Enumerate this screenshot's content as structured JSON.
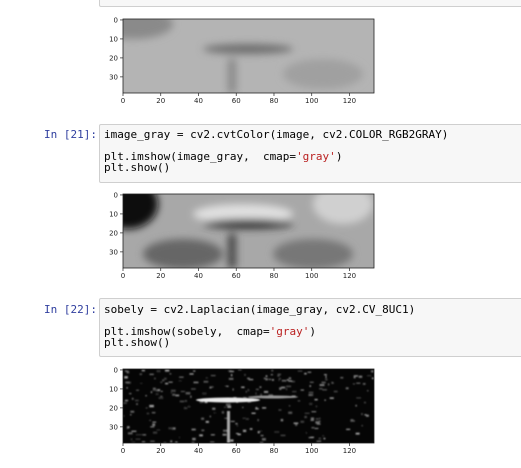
{
  "cells": [
    {
      "prompt": "",
      "code": []
    },
    {
      "prompt": "In [21]:",
      "code": [
        {
          "a": "image_gray = cv2.cvtColor(image, cv2.COLOR_RGB2GRAY)",
          "s": "",
          "b": ""
        },
        {
          "a": "",
          "s": "",
          "b": ""
        },
        {
          "a": "plt.imshow(image_gray,  cmap=",
          "s": "'gray'",
          "b": ")"
        },
        {
          "a": "plt.show()",
          "s": "",
          "b": ""
        }
      ]
    },
    {
      "prompt": "In [22]:",
      "code": [
        {
          "a": "sobely = cv2.Laplacian(image_gray, cv2.CV_8UC1)",
          "s": "",
          "b": ""
        },
        {
          "a": "",
          "s": "",
          "b": ""
        },
        {
          "a": "plt.imshow(sobely,  cmap=",
          "s": "'gray'",
          "b": ")"
        },
        {
          "a": "plt.show()",
          "s": "",
          "b": ""
        }
      ]
    }
  ],
  "plots": {
    "x_ticks": [
      "0",
      "20",
      "40",
      "60",
      "80",
      "100",
      "120"
    ],
    "y_ticks": [
      "0",
      "10",
      "20",
      "30"
    ],
    "xlim": [
      0,
      133
    ],
    "ylim": [
      0,
      39
    ],
    "images": [
      "color-blurred",
      "grayscale",
      "laplacian-edges"
    ]
  },
  "colors": {
    "prompt": "#303f9f",
    "string": "#ba2121"
  }
}
